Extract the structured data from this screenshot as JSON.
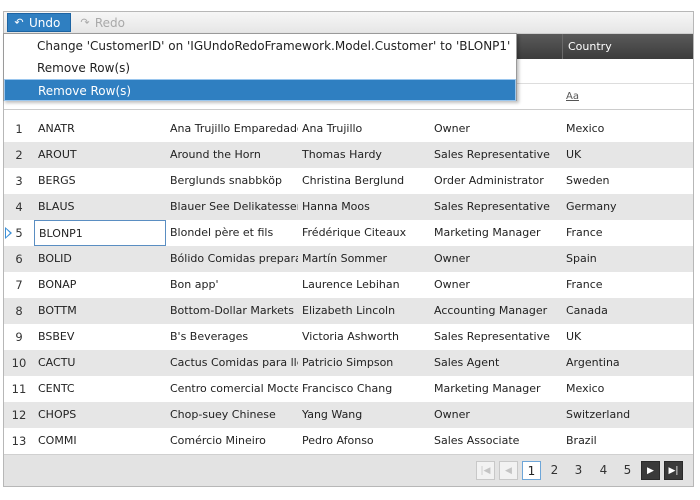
{
  "toolbar": {
    "undo_label": "Undo",
    "redo_label": "Redo"
  },
  "undo_menu": {
    "items": [
      "Change 'CustomerID' on 'IGUndoRedoFramework.Model.Customer' to 'BLONP1'",
      "Remove Row(s)",
      "Remove Row(s)"
    ],
    "selected_index": 2
  },
  "grid": {
    "visible_header": "Country",
    "filter_operator": "Aa",
    "rows": [
      {
        "num": "1",
        "id": "ANATR",
        "company": "Ana Trujillo Emparedados",
        "contact": "Ana Trujillo",
        "title": "Owner",
        "country": "Mexico"
      },
      {
        "num": "2",
        "id": "AROUT",
        "company": "Around the Horn",
        "contact": "Thomas Hardy",
        "title": "Sales Representative",
        "country": "UK"
      },
      {
        "num": "3",
        "id": "BERGS",
        "company": "Berglunds snabbköp",
        "contact": "Christina Berglund",
        "title": "Order Administrator",
        "country": "Sweden"
      },
      {
        "num": "4",
        "id": "BLAUS",
        "company": "Blauer See Delikatessen",
        "contact": "Hanna Moos",
        "title": "Sales Representative",
        "country": "Germany"
      },
      {
        "num": "5",
        "id": "BLONP1",
        "company": "Blondel père et fils",
        "contact": "Frédérique Citeaux",
        "title": "Marketing Manager",
        "country": "France"
      },
      {
        "num": "6",
        "id": "BOLID",
        "company": "Bólido Comidas preparad",
        "contact": "Martín Sommer",
        "title": "Owner",
        "country": "Spain"
      },
      {
        "num": "7",
        "id": "BONAP",
        "company": "Bon app'",
        "contact": "Laurence Lebihan",
        "title": "Owner",
        "country": "France"
      },
      {
        "num": "8",
        "id": "BOTTM",
        "company": "Bottom-Dollar Markets",
        "contact": "Elizabeth Lincoln",
        "title": "Accounting Manager",
        "country": "Canada"
      },
      {
        "num": "9",
        "id": "BSBEV",
        "company": "B's Beverages",
        "contact": "Victoria Ashworth",
        "title": "Sales Representative",
        "country": "UK"
      },
      {
        "num": "10",
        "id": "CACTU",
        "company": "Cactus Comidas para lleva",
        "contact": "Patricio Simpson",
        "title": "Sales Agent",
        "country": "Argentina"
      },
      {
        "num": "11",
        "id": "CENTC",
        "company": "Centro comercial Moctezu",
        "contact": "Francisco Chang",
        "title": "Marketing Manager",
        "country": "Mexico"
      },
      {
        "num": "12",
        "id": "CHOPS",
        "company": "Chop-suey Chinese",
        "contact": "Yang Wang",
        "title": "Owner",
        "country": "Switzerland"
      },
      {
        "num": "13",
        "id": "COMMI",
        "company": "Comércio Mineiro",
        "contact": "Pedro Afonso",
        "title": "Sales Associate",
        "country": "Brazil"
      }
    ]
  },
  "pager": {
    "pages": [
      "1",
      "2",
      "3",
      "4",
      "5"
    ],
    "current": "1"
  },
  "colors": {
    "accent": "#2f7fc1",
    "header_bg": "#4a4a4a",
    "alt_row": "#e6e6e6"
  }
}
